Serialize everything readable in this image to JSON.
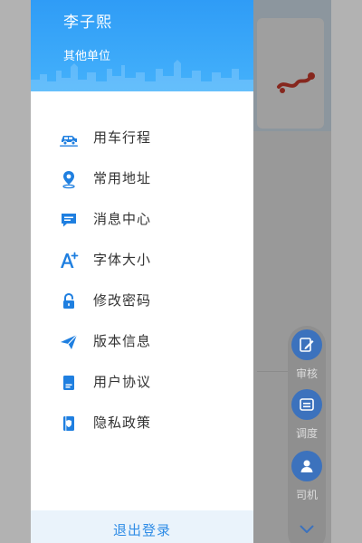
{
  "drawer": {
    "user_name": "李子熙",
    "user_org": "其他单位",
    "menu": [
      {
        "label": "用车行程",
        "icon": "car-trip-icon"
      },
      {
        "label": "常用地址",
        "icon": "location-pin-icon"
      },
      {
        "label": "消息中心",
        "icon": "message-icon"
      },
      {
        "label": "字体大小",
        "icon": "font-size-icon"
      },
      {
        "label": "修改密码",
        "icon": "lock-icon"
      },
      {
        "label": "版本信息",
        "icon": "paper-plane-icon"
      },
      {
        "label": "用户协议",
        "icon": "agreement-doc-icon"
      },
      {
        "label": "隐私政策",
        "icon": "privacy-book-icon"
      }
    ],
    "logout_label": "退出登录"
  },
  "quick_actions": [
    {
      "label": "审核",
      "icon": "review-edit-icon"
    },
    {
      "label": "调度",
      "icon": "dispatch-icon"
    },
    {
      "label": "司机",
      "icon": "driver-icon"
    }
  ],
  "colors": {
    "header_gradient_top": "#2f9cf6",
    "header_gradient_bottom": "#44b1fb",
    "icon_blue": "#1f7fe0",
    "logout_text": "#2f8ce6",
    "menu_text": "#333333",
    "fab_circle": "#3c72bd"
  }
}
